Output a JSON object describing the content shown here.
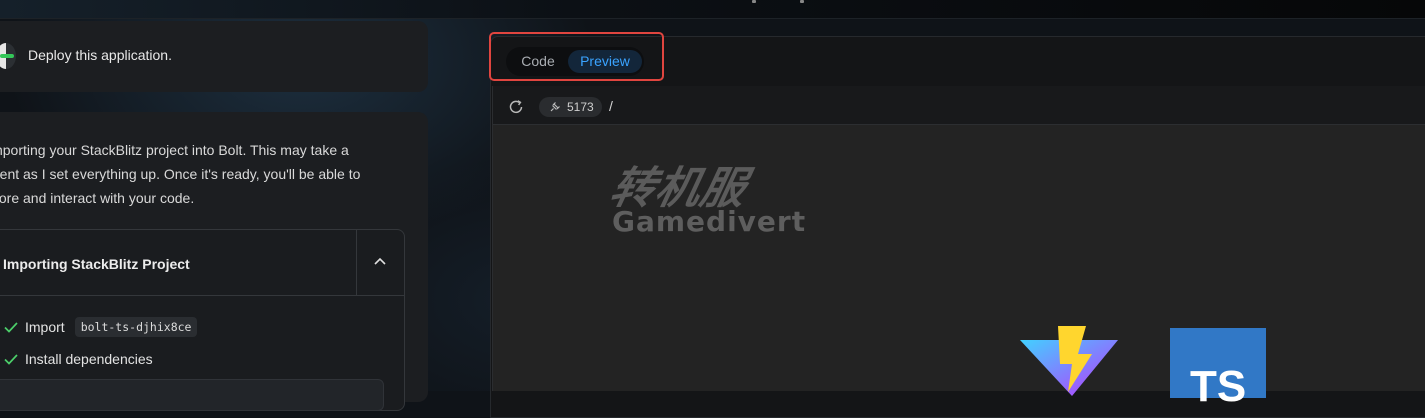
{
  "chat": {
    "user_message": "Deploy this application.",
    "assistant_lines": [
      "importing your StackBlitz project into Bolt. This may take a",
      "ment as I set everything up. Once it's ready, you'll be able to",
      "plore and interact with your code."
    ],
    "artifact": {
      "title": "Importing StackBlitz Project",
      "steps": [
        {
          "label": "Import",
          "code": "bolt-ts-djhix8ce"
        },
        {
          "label": "Install dependencies"
        }
      ]
    }
  },
  "workbench": {
    "tabs": [
      {
        "label": "Code",
        "active": false
      },
      {
        "label": "Preview",
        "active": true
      }
    ],
    "highlight_color": "#e0453f",
    "active_tab_color": "#3aa3ff",
    "address_bar": {
      "port": "5173",
      "path": "/"
    },
    "watermark": {
      "cn": "转机服",
      "en": "Gamedivert"
    },
    "logos": {
      "ts": "TS",
      "ts_color": "#3178c6"
    }
  }
}
